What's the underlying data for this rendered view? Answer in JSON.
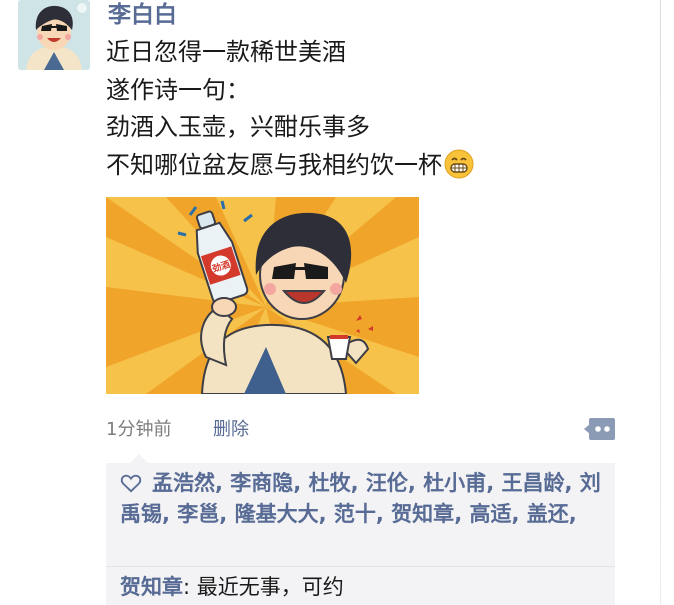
{
  "post": {
    "author": "李白白",
    "lines": [
      "近日忽得一款稀世美酒",
      "遂作诗一句：",
      "劲酒入玉壶，兴酣乐事多",
      "不知哪位盆友愿与我相约饮一杯"
    ],
    "bottle_label": "劲酒",
    "time": "1分钟前",
    "delete_label": "删除"
  },
  "likes": [
    "孟浩然",
    "李商隐",
    "杜牧",
    "汪伦",
    "杜小甫",
    "王昌龄",
    "刘禹锡",
    "李邕",
    "隆基大大",
    "范十",
    "贺知章",
    "高适",
    "盖还"
  ],
  "comments": [
    {
      "author": "贺知章",
      "text": "最近无事，可约"
    }
  ],
  "colors": {
    "link": "#576b95",
    "text": "#1a1a1a",
    "meta": "#7d7d7d",
    "panel": "#f3f3f5",
    "image_bg": "#f0a52a"
  },
  "icons": [
    "user-avatar",
    "grin-emoji",
    "heart-outline-icon",
    "comment-more-icon"
  ]
}
